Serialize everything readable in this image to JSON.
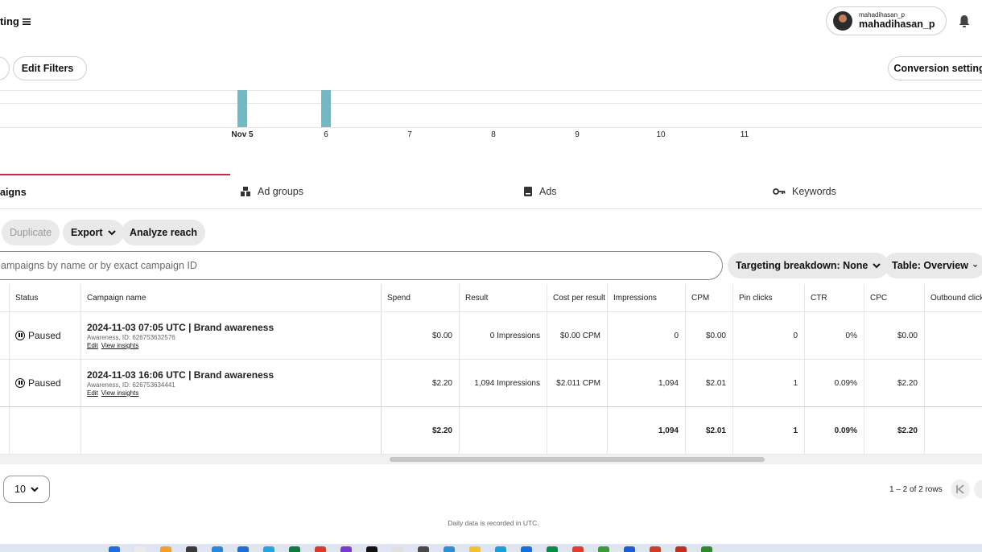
{
  "header": {
    "app_title": "ting",
    "account_small": "mahadihasan_p",
    "account_big": "mahadihasan_p"
  },
  "toolbar": {
    "edit_filters": "Edit Filters",
    "conversion_settings": "Conversion settings"
  },
  "chart_data": {
    "type": "bar",
    "categories": [
      "Nov 5",
      "6",
      "7",
      "8",
      "9",
      "10",
      "11"
    ],
    "bar_color": "#73b8c3"
  },
  "tabs": [
    {
      "label": "aigns",
      "icon": "campaigns-icon"
    },
    {
      "label": "Ad groups",
      "icon": "ad-groups-icon"
    },
    {
      "label": "Ads",
      "icon": "ads-icon"
    },
    {
      "label": "Keywords",
      "icon": "key-icon"
    }
  ],
  "actions": {
    "duplicate": "Duplicate",
    "export": "Export",
    "analyze_reach": "Analyze reach"
  },
  "search": {
    "placeholder": "ampaigns by name or by exact campaign ID"
  },
  "filters": {
    "targeting": "Targeting breakdown: None",
    "table": "Table: Overview"
  },
  "table": {
    "columns": [
      "Status",
      "Campaign name",
      "Spend",
      "Result",
      "Cost per result",
      "Impressions",
      "CPM",
      "Pin clicks",
      "CTR",
      "CPC",
      "Outbound clicks"
    ],
    "rows": [
      {
        "status": "Paused",
        "name": "2024-11-03 07:05 UTC | Brand awareness",
        "sub": "Awareness, ID: 626753632576",
        "edit": "Edit",
        "insights": "View insights",
        "spend": "$0.00",
        "result": "0 Impressions",
        "cpr": "$0.00 CPM",
        "impressions": "0",
        "cpm": "$0.00",
        "pin_clicks": "0",
        "ctr": "0%",
        "cpc": "$0.00"
      },
      {
        "status": "Paused",
        "name": "2024-11-03 16:06 UTC | Brand awareness",
        "sub": "Awareness, ID: 626753634441",
        "edit": "Edit",
        "insights": "View insights",
        "spend": "$2.20",
        "result": "1,094 Impressions",
        "cpr": "$2.011 CPM",
        "impressions": "1,094",
        "cpm": "$2.01",
        "pin_clicks": "1",
        "ctr": "0.09%",
        "cpc": "$2.20"
      }
    ],
    "totals": {
      "spend": "$2.20",
      "impressions": "1,094",
      "cpm": "$2.01",
      "pin_clicks": "1",
      "ctr": "0.09%",
      "cpc": "$2.20"
    }
  },
  "pagination": {
    "page_size": "10",
    "range": "1 – 2 of 2 rows"
  },
  "footer": {
    "note": "Daily data is recorded in UTC."
  }
}
